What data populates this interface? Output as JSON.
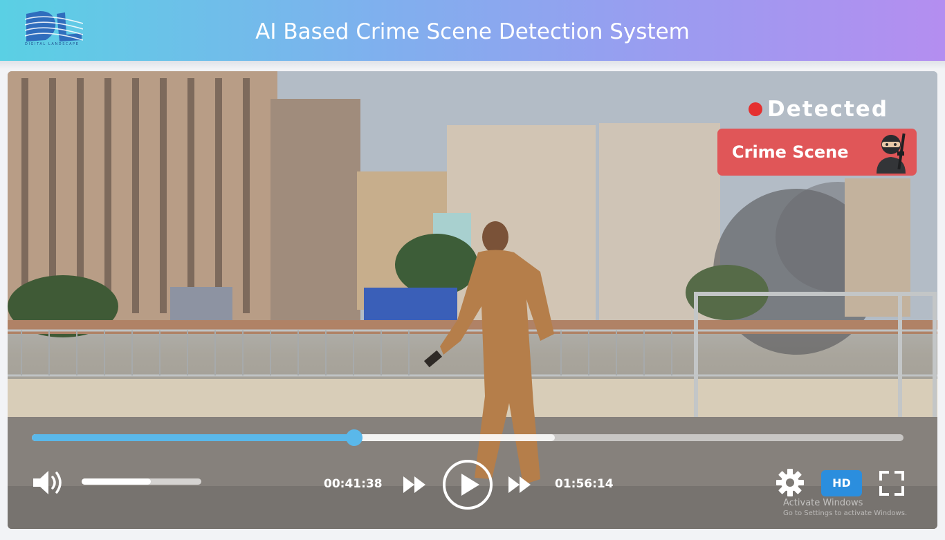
{
  "header": {
    "logo_text": "DIGITAL LANDSCAPE",
    "title": "AI Based Crime Scene Detection System"
  },
  "detection": {
    "status_label": "Detected",
    "status_color": "#e5302f",
    "category_label": "Crime Scene",
    "category_color": "#e05658",
    "category_icon": "masked-criminal-with-gun-icon"
  },
  "player": {
    "current_time": "00:41:38",
    "total_time": "01:56:14",
    "progress_fraction": 0.37,
    "buffered_fraction": 0.6,
    "volume_fraction": 0.58,
    "quality_label": "HD",
    "accent_color": "#5ab8ea",
    "icons": {
      "volume": "volume-icon",
      "rewind": "rewind-icon",
      "play": "play-icon",
      "forward": "fast-forward-icon",
      "settings": "gear-icon",
      "fullscreen": "fullscreen-icon"
    }
  },
  "watermark": {
    "title": "Activate Windows",
    "subtitle": "Go to Settings to activate Windows."
  }
}
